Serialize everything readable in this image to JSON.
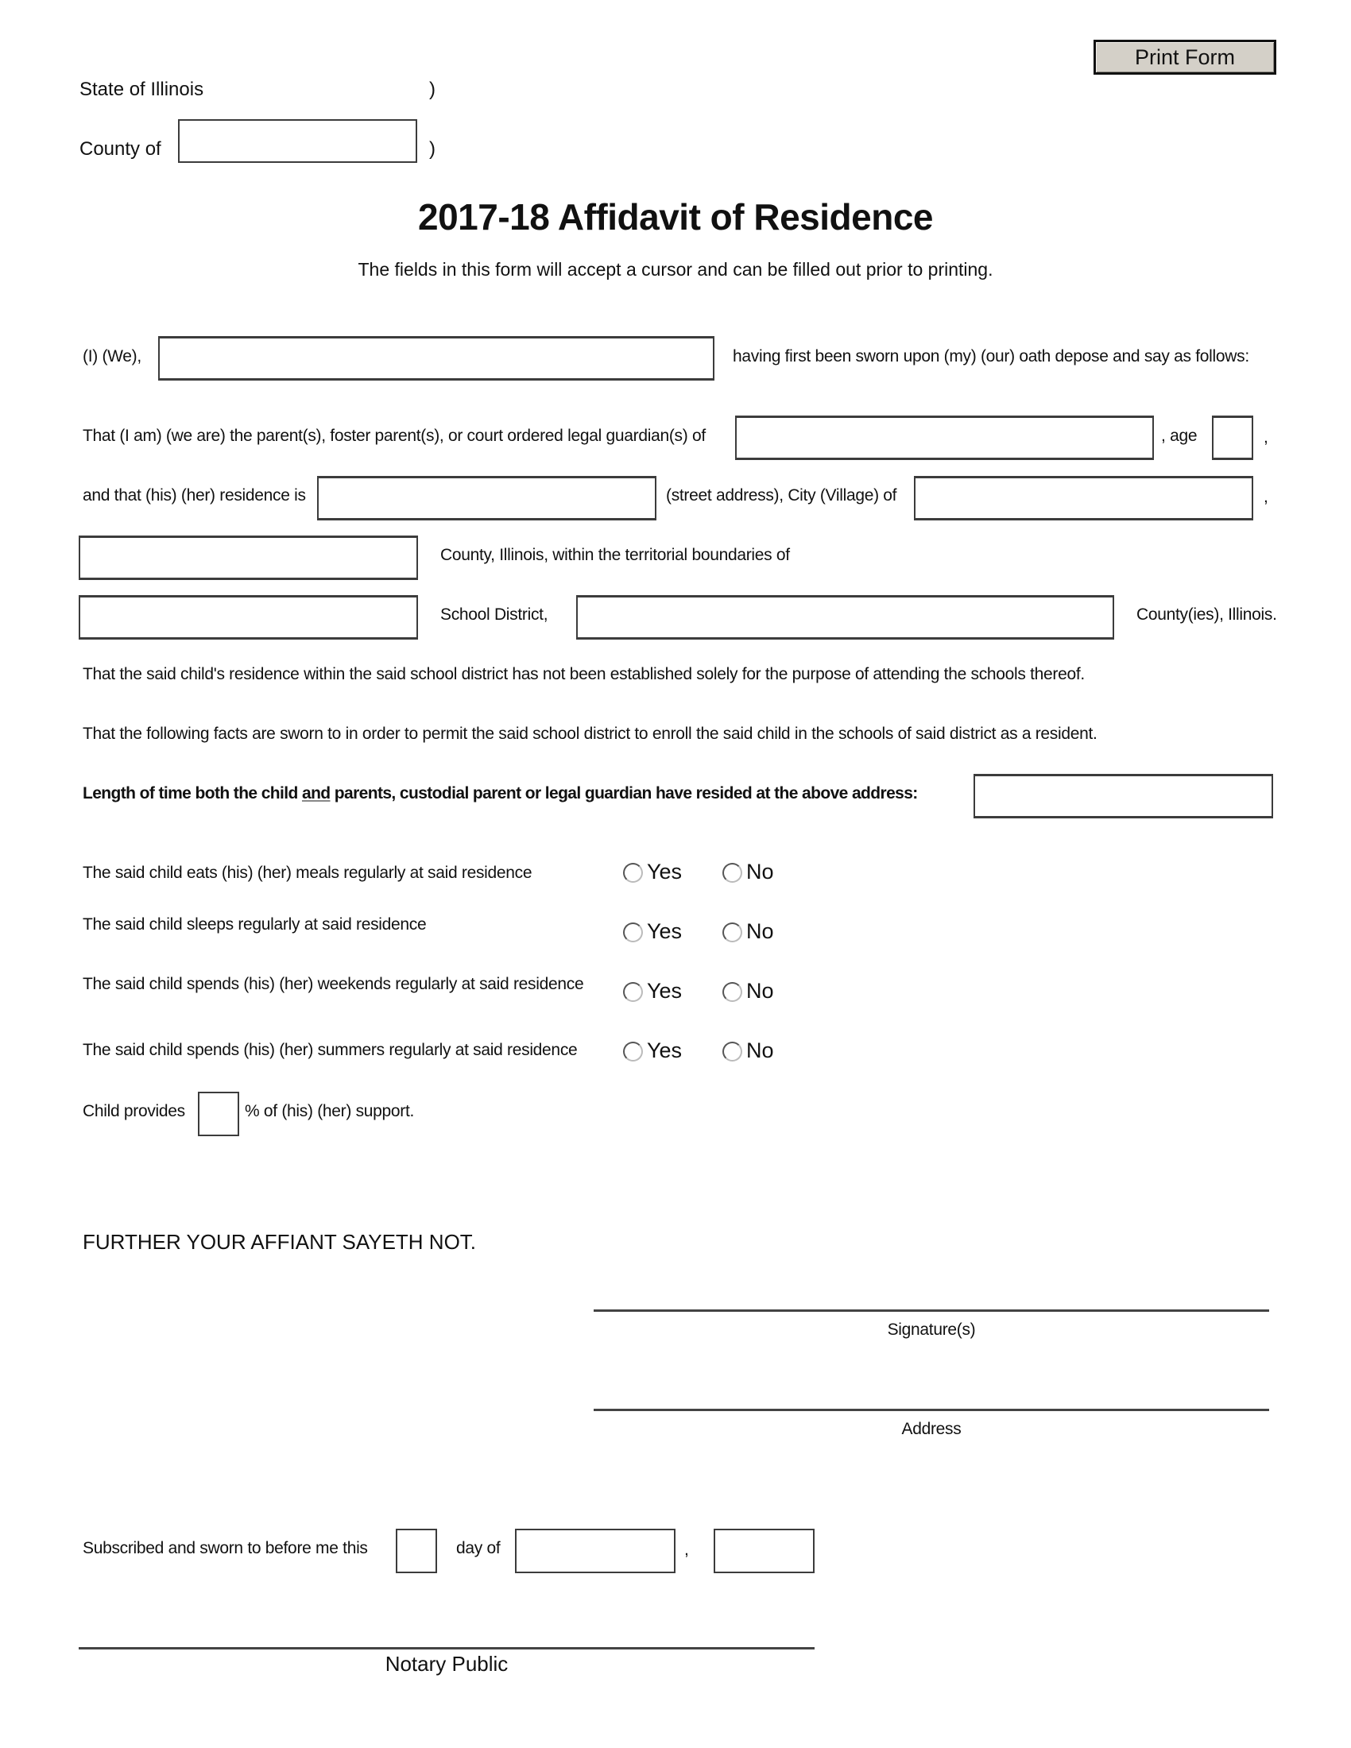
{
  "toolbar": {
    "print_label": "Print Form"
  },
  "header": {
    "state_label": "State of Illinois",
    "county_label": "County of",
    "paren": ")",
    "county_value": ""
  },
  "title": "2017-18 Affidavit of Residence",
  "subtitle": "The fields in this form will accept a cursor and can be filled out prior to printing.",
  "affiant": {
    "prefix": "(I) (We),",
    "suffix": "having first been sworn upon (my) (our) oath depose and say as follows:",
    "name_value": ""
  },
  "child": {
    "prefix": "That (I am) (we are) the parent(s), foster parent(s), or court ordered legal guardian(s) of",
    "age_label": ", age",
    "trailing_comma": ",",
    "name_value": "",
    "age_value": ""
  },
  "residence": {
    "prefix": "and that (his) (her) residence is",
    "street_suffix": "(street address), City (Village) of",
    "trailing_comma": ",",
    "county_suffix": "County, Illinois, within the territorial boundaries of",
    "district_label": "School District,",
    "counties_suffix": "County(ies), Illinois.",
    "street_value": "",
    "city_value": "",
    "county_value": "",
    "district_value": "",
    "counties_value": ""
  },
  "statements": {
    "not_solely": "That the said child's residence within the said school district has not been established solely for the purpose of attending the schools thereof.",
    "facts_sworn": "That the following facts are sworn to in order to permit the said school district to enroll the said child in the schools of said district as a resident."
  },
  "length_of_time": {
    "part1": "Length of time both the child ",
    "underlined": "and",
    "part2": " parents, custodial parent or legal guardian have resided at the above address:",
    "value": ""
  },
  "questions": [
    {
      "text": "The said child eats (his) (her) meals regularly at said residence",
      "yes": "Yes",
      "no": "No",
      "selected": null
    },
    {
      "text": "The said child sleeps regularly at said residence",
      "yes": "Yes",
      "no": "No",
      "selected": null
    },
    {
      "text": "The said child spends (his) (her) weekends regularly at said residence",
      "yes": "Yes",
      "no": "No",
      "selected": null
    },
    {
      "text": "The said child spends (his) (her) summers regularly at said residence",
      "yes": "Yes",
      "no": "No",
      "selected": null
    }
  ],
  "support": {
    "prefix": "Child provides",
    "suffix": "% of (his) (her) support.",
    "value": ""
  },
  "closing": "FURTHER YOUR AFFIANT SAYETH NOT.",
  "signature_label": "Signature(s)",
  "address_label": "Address",
  "notary": {
    "prefix": "Subscribed and sworn to before me this",
    "day_of": "day of",
    "comma": ",",
    "day_value": "",
    "month_value": "",
    "year_value": "",
    "label": "Notary Public"
  }
}
